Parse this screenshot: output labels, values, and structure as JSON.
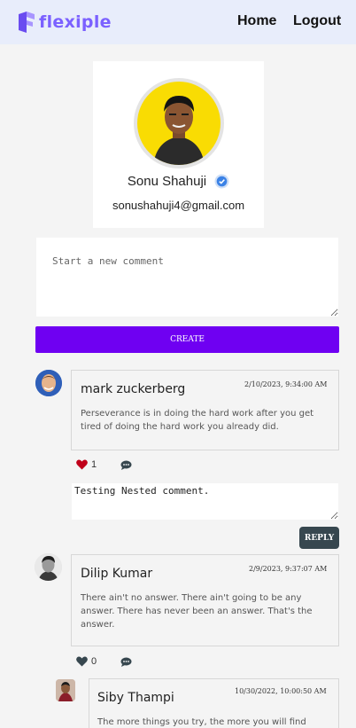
{
  "navbar": {
    "logo_text": "flexiple",
    "links": [
      {
        "label": "Home"
      },
      {
        "label": "Logout"
      }
    ]
  },
  "profile": {
    "name": "Sonu Shahuji",
    "email": "sonushahuji4@gmail.com",
    "verified_icon": "verified-check-icon",
    "avatar_bg": "#f9dc03"
  },
  "new_comment": {
    "placeholder": "Start a new comment",
    "button_label": "CREATE",
    "button_color": "#6f00f2"
  },
  "comments": [
    {
      "author": "mark zuckerberg",
      "date": "2/10/2023, 9:34:00 AM",
      "text": "Perseverance is in doing the hard work after you get tired of doing the hard work you already did.",
      "likes": "1",
      "liked": true
    },
    {
      "author": "Dilip Kumar",
      "date": "2/9/2023, 9:37:07 AM",
      "text": "There ain't no answer. There ain't going to be any answer. There has never been an answer. That's the answer.",
      "likes": "0",
      "liked": false
    },
    {
      "author": "Siby Thampi",
      "date": "10/30/2022, 10:00:50 AM",
      "text": "The more things you try, the more you will find"
    }
  ],
  "reply_box": {
    "value": "Testing Nested comment.",
    "button_label": "REPLY"
  },
  "colors": {
    "like_active": "#c0001a",
    "like_inactive": "#37474f",
    "reply_button": "#37474f"
  }
}
